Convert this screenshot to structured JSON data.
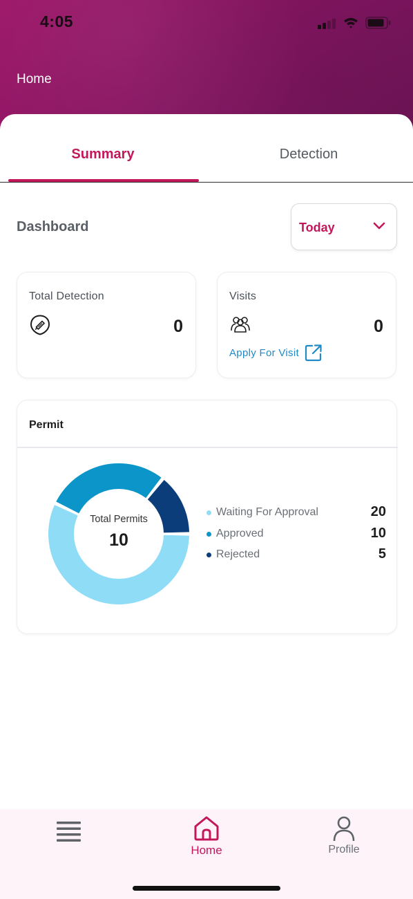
{
  "status_bar": {
    "time": "4:05"
  },
  "header": {
    "title": "Home"
  },
  "tabs": [
    {
      "label": "Summary",
      "active": true
    },
    {
      "label": "Detection",
      "active": false
    }
  ],
  "dashboard": {
    "label": "Dashboard",
    "period_select": {
      "value": "Today",
      "icon": "chevron-down-icon"
    }
  },
  "cards": {
    "total_detection": {
      "label": "Total Detection",
      "value": "0",
      "icon": "detection-shield-icon"
    },
    "visits": {
      "label": "Visits",
      "value": "0",
      "icon": "group-people-icon",
      "link_label": "Apply For Visit",
      "link_icon": "external-link-icon"
    }
  },
  "permit": {
    "title": "Permit",
    "center_label": "Total Permits",
    "center_value": "10",
    "legend": [
      {
        "label": "Waiting For Approval",
        "value": "20",
        "color": "#8fdcf7"
      },
      {
        "label": "Approved",
        "value": "10",
        "color": "#0b95c8"
      },
      {
        "label": "Rejected",
        "value": "5",
        "color": "#0a3d7a"
      }
    ]
  },
  "bottom_nav": {
    "items": [
      {
        "label": "",
        "icon": "menu-icon",
        "active": false
      },
      {
        "label": "Home",
        "icon": "home-icon",
        "active": true
      },
      {
        "label": "Profile",
        "icon": "profile-icon",
        "active": false
      }
    ]
  },
  "colors": {
    "accent": "#c2185b",
    "header_bg": "#8a1462",
    "link": "#1f8ac6",
    "nav_bg": "#fdf3f8"
  }
}
